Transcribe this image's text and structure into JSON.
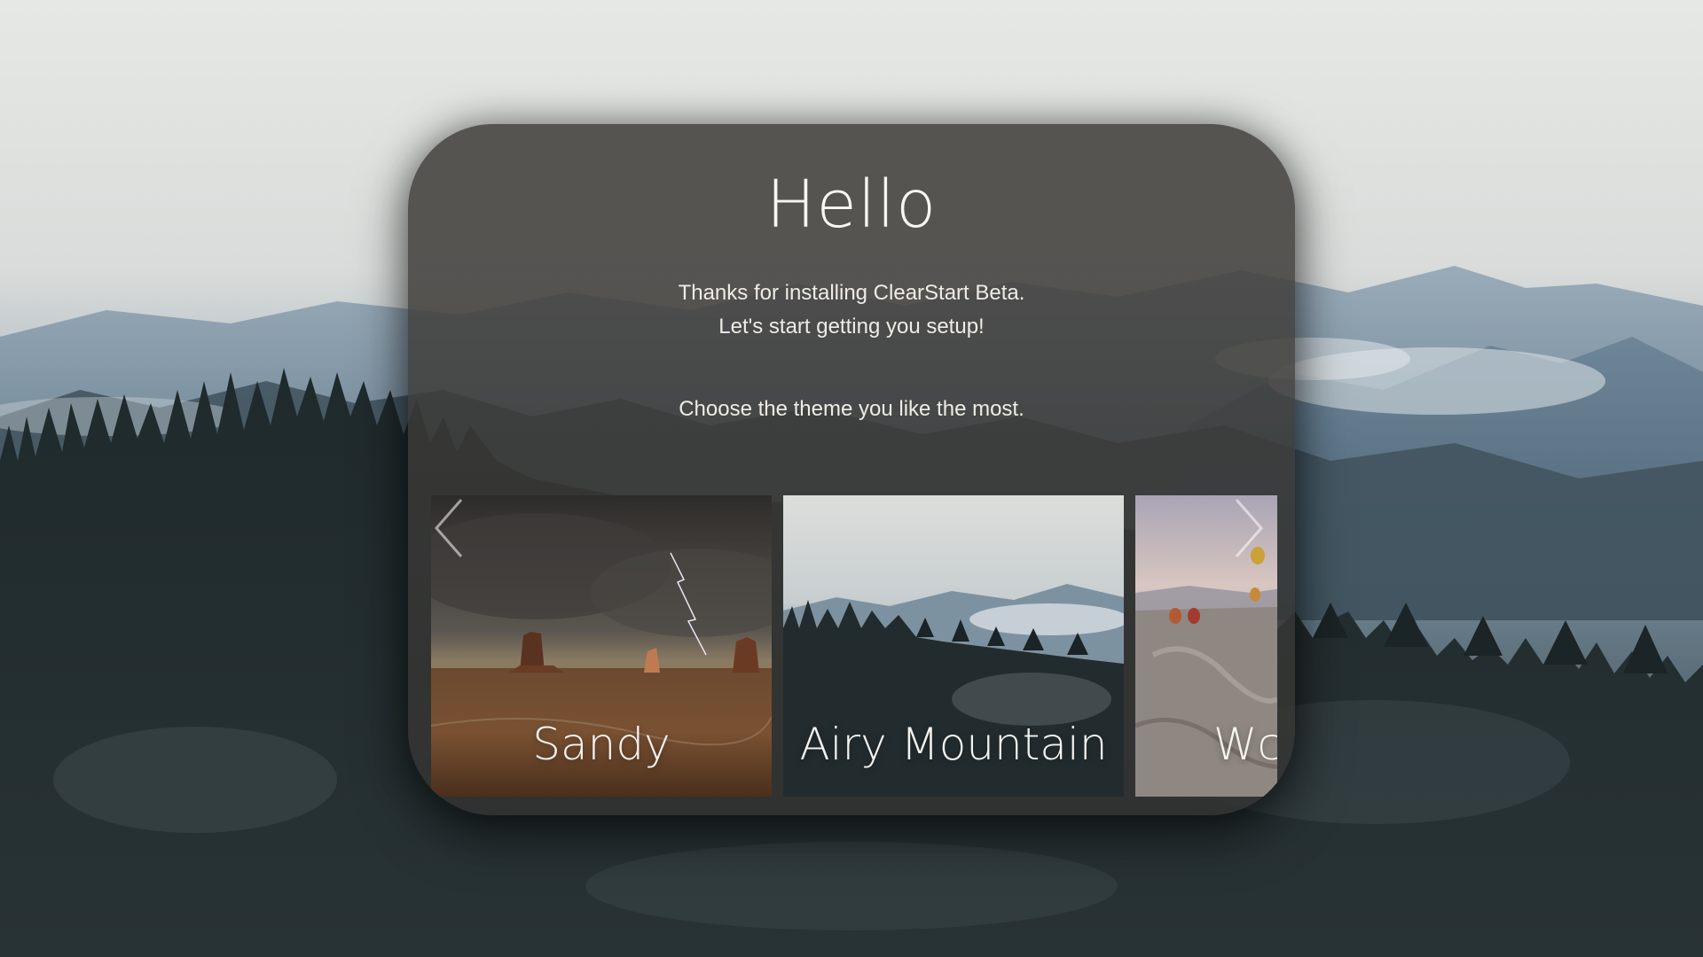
{
  "welcome": {
    "title": "Hello",
    "intro_line1": "Thanks for installing ClearStart Beta.",
    "intro_line2": "Let's start getting you setup!",
    "prompt": "Choose the theme you like the most."
  },
  "themes": [
    {
      "label": "Sandy"
    },
    {
      "label": "Airy Mountain"
    },
    {
      "label": "Wc"
    }
  ],
  "navigation": {
    "prev_icon": "chevron-left-icon",
    "next_icon": "chevron-right-icon"
  },
  "colors": {
    "card_background": "#3a3836",
    "text": "#f2f0ec"
  }
}
